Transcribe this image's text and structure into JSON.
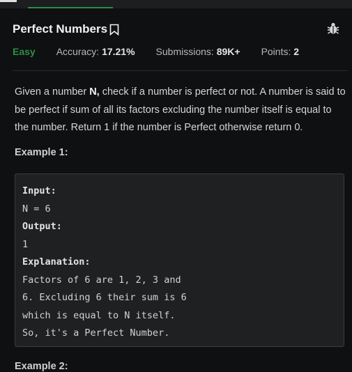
{
  "problem": {
    "title": "Perfect Numbers",
    "difficulty": "Easy",
    "accuracy_label": "Accuracy:",
    "accuracy_value": "17.21%",
    "submissions_label": "Submissions:",
    "submissions_value": "89K+",
    "points_label": "Points:",
    "points_value": "2"
  },
  "description": {
    "part1": "Given a number ",
    "bold": "N,",
    "part2": " check if a number is perfect or not. A number is said to be perfect if sum of all its factors excluding the number itself is equal to the number. Return 1 if the number is Perfect otherwise return 0."
  },
  "example1": {
    "title": "Example 1:",
    "input_label": "Input:",
    "input_value": "N = 6",
    "output_label": "Output:",
    "output_value": "1",
    "explanation_label": "Explanation:",
    "explanation_text": "Factors of 6 are 1, 2, 3 and 6. Excluding 6 their sum is 6 which is equal to N itself. So, it's a Perfect Number."
  },
  "example2": {
    "title": "Example 2:"
  },
  "icons": {
    "bookmark": "bookmark-icon",
    "bug": "bug-icon"
  },
  "colors": {
    "accent_green": "#2f8d46",
    "background": "#0f1011",
    "box_background": "#1f2022"
  }
}
